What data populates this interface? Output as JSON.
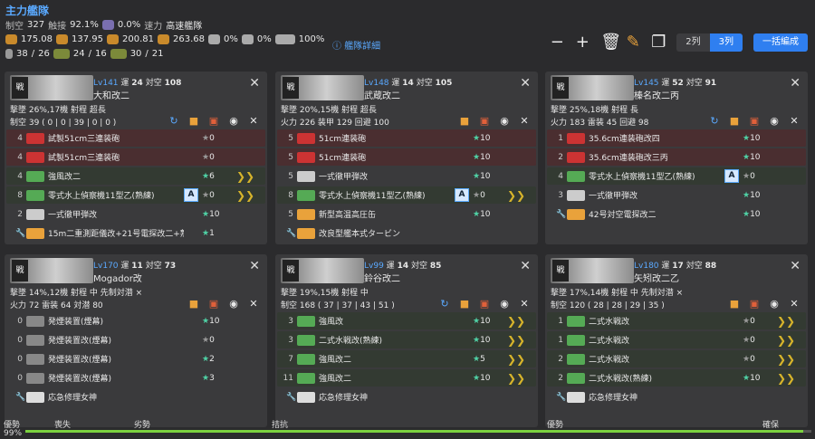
{
  "fleet_title": "主力艦隊",
  "stats_row1": {
    "air_label": "制空",
    "air": "327",
    "evade_label": "触接",
    "evade": "92.1%",
    "anti": "0.0%",
    "speed_label": "速力",
    "speed": "高速艦隊"
  },
  "stats_row2": [
    "175.08",
    "137.95",
    "200.81",
    "263.68",
    "0%",
    "0%",
    "100%"
  ],
  "stats_row3": [
    "38",
    "26",
    "24",
    "16",
    "30",
    "21"
  ],
  "fleet_detail": "艦隊詳細",
  "buttons": {
    "col2": "2列",
    "col3": "3列",
    "bulk": "一括編成"
  },
  "ships": [
    {
      "lv": "Lv141",
      "luck_label": "運",
      "luck": "24",
      "aa_label": "対空",
      "aa": "108",
      "name": "大和改二",
      "line3": "撃墜 26%,17機  射程 超長",
      "line4": "制空 39 ( 0 | 0 | 39 | 0 | 0 )",
      "equips": [
        {
          "n": "4",
          "name": "試製51cm三連装砲",
          "imp": "0",
          "col": "red",
          "g": "#c33"
        },
        {
          "n": "4",
          "name": "試製51cm三連装砲",
          "imp": "0",
          "col": "red",
          "g": "#c33"
        },
        {
          "n": "4",
          "name": "強風改二",
          "imp": "6",
          "col": "grn",
          "g": "#5a5",
          "ch": "❯❯"
        },
        {
          "n": "8",
          "name": "零式水上偵察機11型乙(熟練)",
          "imp": "0",
          "col": "grn",
          "g": "#5a5",
          "pf": "A",
          "ch": "❯❯"
        },
        {
          "n": "2",
          "name": "一式徹甲弾改",
          "imp": "10",
          "col": "plain",
          "g": "#ccc"
        },
        {
          "n": "",
          "name": "15m二重測距儀改+21号電探改二+熟練…",
          "imp": "1",
          "col": "plain",
          "g": "#e9a23b"
        }
      ]
    },
    {
      "lv": "Lv148",
      "luck_label": "運",
      "luck": "14",
      "aa_label": "対空",
      "aa": "105",
      "name": "武蔵改二",
      "line3": "撃墜 20%,15機  射程 超長",
      "line4": "火力 226  装甲 129  回避 100",
      "equips": [
        {
          "n": "5",
          "name": "51cm連装砲",
          "imp": "10",
          "col": "red",
          "g": "#c33"
        },
        {
          "n": "5",
          "name": "51cm連装砲",
          "imp": "10",
          "col": "red",
          "g": "#c33"
        },
        {
          "n": "5",
          "name": "一式徹甲弾改",
          "imp": "10",
          "col": "plain",
          "g": "#ccc"
        },
        {
          "n": "8",
          "name": "零式水上偵察機11型乙(熟練)",
          "imp": "0",
          "col": "grn",
          "g": "#5a5",
          "pf": "A",
          "ch": "❯❯"
        },
        {
          "n": "5",
          "name": "新型高温高圧缶",
          "imp": "10",
          "col": "plain",
          "g": "#e9a23b"
        },
        {
          "n": "",
          "name": "改良型艦本式タービン",
          "imp": "",
          "col": "plain",
          "g": "#e9a23b"
        }
      ]
    },
    {
      "lv": "Lv145",
      "luck_label": "運",
      "luck": "52",
      "aa_label": "対空",
      "aa": "91",
      "name": "榛名改二丙",
      "line3": "撃墜 25%,18機  射程 長",
      "line4": "火力 183  雷装 45  回避 98",
      "equips": [
        {
          "n": "1",
          "name": "35.6cm連装砲改四",
          "imp": "10",
          "col": "red",
          "g": "#c33"
        },
        {
          "n": "2",
          "name": "35.6cm連装砲改三丙",
          "imp": "10",
          "col": "red",
          "g": "#c33"
        },
        {
          "n": "4",
          "name": "零式水上偵察機11型乙(熟練)",
          "imp": "0",
          "col": "grn",
          "g": "#5a5",
          "pf": "A"
        },
        {
          "n": "3",
          "name": "一式徹甲弾改",
          "imp": "10",
          "col": "plain",
          "g": "#ccc"
        },
        {
          "n": "",
          "name": "42号対空電探改二",
          "imp": "10",
          "col": "plain",
          "g": "#e9a23b"
        }
      ]
    },
    {
      "lv": "Lv170",
      "luck_label": "運",
      "luck": "11",
      "aa_label": "対空",
      "aa": "73",
      "name": "Mogador改",
      "line3": "撃墜 14%,12機  射程 中  先制対潜 ×",
      "line4": "火力 72  雷装 64  対潜 80",
      "equips": [
        {
          "n": "0",
          "name": "発煙装置(煙幕)",
          "imp": "10",
          "col": "plain",
          "g": "#888"
        },
        {
          "n": "0",
          "name": "発煙装置改(煙幕)",
          "imp": "0",
          "col": "plain",
          "g": "#888"
        },
        {
          "n": "0",
          "name": "発煙装置改(煙幕)",
          "imp": "2",
          "col": "plain",
          "g": "#888"
        },
        {
          "n": "0",
          "name": "発煙装置改(煙幕)",
          "imp": "3",
          "col": "plain",
          "g": "#888"
        },
        {
          "n": "",
          "name": "応急修理女神",
          "imp": "",
          "col": "plain",
          "g": "#ddd"
        }
      ]
    },
    {
      "lv": "Lv99",
      "luck_label": "運",
      "luck": "14",
      "aa_label": "対空",
      "aa": "85",
      "name": "鈴谷改二",
      "line3": "撃墜 19%,15機  射程 中",
      "line4": "制空 168 ( 37 | 37 | 43 | 51 )",
      "equips": [
        {
          "n": "3",
          "name": "強風改",
          "imp": "10",
          "col": "grn",
          "g": "#5a5",
          "ch": "❯❯"
        },
        {
          "n": "3",
          "name": "二式水戦改(熟練)",
          "imp": "10",
          "col": "grn",
          "g": "#5a5",
          "ch": "❯❯"
        },
        {
          "n": "7",
          "name": "強風改二",
          "imp": "5",
          "col": "grn",
          "g": "#5a5",
          "ch": "❯❯"
        },
        {
          "n": "11",
          "name": "強風改二",
          "imp": "10",
          "col": "grn",
          "g": "#5a5",
          "ch": "❯❯"
        },
        {
          "n": "",
          "name": "応急修理女神",
          "imp": "",
          "col": "plain",
          "g": "#ddd"
        }
      ]
    },
    {
      "lv": "Lv180",
      "luck_label": "運",
      "luck": "17",
      "aa_label": "対空",
      "aa": "88",
      "name": "矢矧改二乙",
      "line3": "撃墜 17%,14機  射程 中  先制対潜 ×",
      "line4": "制空 120 ( 28 | 28 | 29 | 35 )",
      "equips": [
        {
          "n": "1",
          "name": "二式水戦改",
          "imp": "0",
          "col": "grn",
          "g": "#5a5",
          "ch": "❯❯"
        },
        {
          "n": "1",
          "name": "二式水戦改",
          "imp": "0",
          "col": "grn",
          "g": "#5a5",
          "ch": "❯❯"
        },
        {
          "n": "2",
          "name": "二式水戦改",
          "imp": "0",
          "col": "grn",
          "g": "#5a5",
          "ch": "❯❯"
        },
        {
          "n": "2",
          "name": "二式水戦改(熟練)",
          "imp": "10",
          "col": "grn",
          "g": "#5a5",
          "ch": "❯❯"
        },
        {
          "n": "",
          "name": "応急修理女神",
          "imp": "",
          "col": "plain",
          "g": "#ddd"
        }
      ]
    }
  ],
  "progress": {
    "labels": [
      "優勢",
      "喪失",
      "劣勢",
      "拮抗",
      "優勢",
      "確保"
    ],
    "value": "99%",
    "fraction": 0.99
  }
}
